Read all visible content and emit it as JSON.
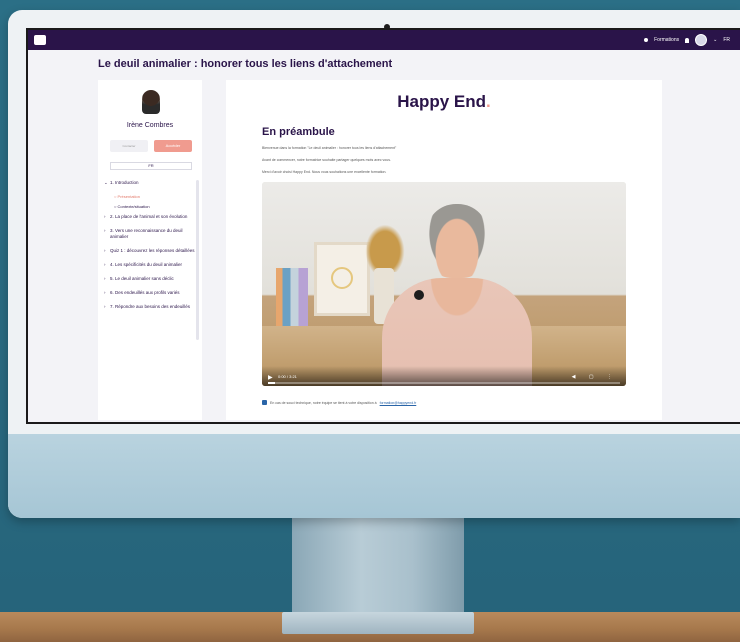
{
  "app": {
    "page_title": "Le deuil animalier : honorer tous les liens d'attachement",
    "topbar": {
      "nav_label": "Formations",
      "lang": "FR"
    }
  },
  "sidebar": {
    "trainer_name": "Irène Combres",
    "button_primary": "Accéder",
    "button_secondary": "Contacter",
    "selector_label": "FR",
    "items": [
      {
        "label": "1. Introduction",
        "expanded": true
      },
      {
        "label": "2. La place de l'animal et son évolution"
      },
      {
        "label": "3. Vers une reconnaissance du deuil animalier"
      },
      {
        "label": "Quiz 1 : découvrez les réponses détaillées"
      },
      {
        "label": "4. Les spécificités du deuil animalier"
      },
      {
        "label": "5. Le deuil animalier sans déclic"
      },
      {
        "label": "6. Des endeuillés aux profils variés"
      },
      {
        "label": "7. Répondre aux besoins des endeuillés"
      }
    ],
    "subitems": [
      {
        "label": "Présentation",
        "active": true
      },
      {
        "label": "Contexte/situation",
        "active": false
      }
    ]
  },
  "main": {
    "brand_name": "Happy End",
    "brand_suffix": ".",
    "heading": "En préambule",
    "paragraphs": [
      "Bienvenue dans la formation \"Le deuil animalier : honorer tous les liens d'attachement\"",
      "Avant de commencer, notre formatrice souhaite partager quelques mots avec vous.",
      "Merci d'avoir choisi Happy End. Nous vous souhaitons une excellente formation."
    ],
    "video": {
      "time": "0:00 / 3:21",
      "progress": 0.02
    },
    "note_text": "En cas de souci technique, notre équipe se tient à votre disposition à",
    "note_link": "formation@happyend.fr"
  },
  "colors": {
    "brand": "#2a1449",
    "accent": "#f09b8f",
    "link": "#2a65a8"
  }
}
